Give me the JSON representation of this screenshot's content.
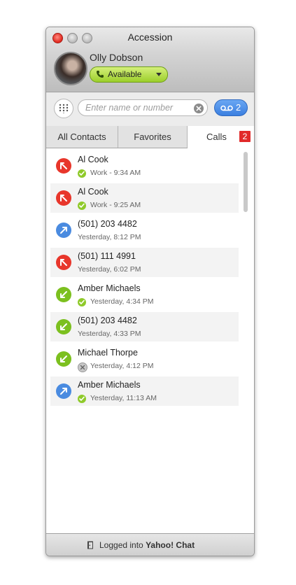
{
  "window": {
    "title": "Accession"
  },
  "profile": {
    "name": "Olly Dobson",
    "status": "Available",
    "status_color": "#9ccf2b"
  },
  "search": {
    "placeholder": "Enter name or number",
    "value": "",
    "voicemail_count": "2"
  },
  "tabs": [
    {
      "label": "All Contacts",
      "active": false
    },
    {
      "label": "Favorites",
      "active": false
    },
    {
      "label": "Calls",
      "active": true,
      "badge": "2"
    }
  ],
  "calls": [
    {
      "name": "Al Cook",
      "detail": "Work - 9:34 AM",
      "direction": "missed",
      "presence": "available"
    },
    {
      "name": "Al Cook",
      "detail": "Work - 9:25 AM",
      "direction": "missed",
      "presence": "available"
    },
    {
      "name": "(501) 203 4482",
      "detail": "Yesterday, 8:12 PM",
      "direction": "outgoing",
      "presence": "none"
    },
    {
      "name": "(501) 111 4991",
      "detail": "Yesterday, 6:02 PM",
      "direction": "missed",
      "presence": "none"
    },
    {
      "name": "Amber Michaels",
      "detail": "Yesterday, 4:34 PM",
      "direction": "incoming",
      "presence": "available"
    },
    {
      "name": "(501) 203 4482",
      "detail": "Yesterday, 4:33 PM",
      "direction": "incoming",
      "presence": "none"
    },
    {
      "name": "Michael Thorpe",
      "detail": "Yesterday, 4:12 PM",
      "direction": "incoming",
      "presence": "offline"
    },
    {
      "name": "Amber Michaels",
      "detail": "Yesterday, 11:13 AM",
      "direction": "outgoing",
      "presence": "available"
    }
  ],
  "footer": {
    "prefix": "Logged into ",
    "service": "Yahoo! Chat"
  },
  "colors": {
    "missed": "#e8362b",
    "incoming": "#7cc01f",
    "outgoing": "#4a8be0",
    "available": "#8fca2a",
    "offline": "#c8c8c8",
    "badge": "#e12a2a"
  },
  "icons": {
    "missed": "missed-call-icon",
    "incoming": "incoming-call-icon",
    "outgoing": "outgoing-call-icon",
    "available": "available-presence-icon",
    "offline": "offline-presence-icon"
  }
}
